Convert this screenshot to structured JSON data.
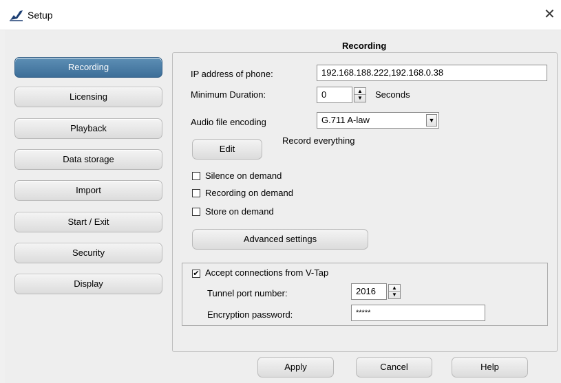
{
  "window": {
    "title": "Setup"
  },
  "section_title": "Recording",
  "sidebar": {
    "items": [
      {
        "label": "Recording",
        "active": true
      },
      {
        "label": "Licensing"
      },
      {
        "label": "Playback"
      },
      {
        "label": "Data storage"
      },
      {
        "label": "Import"
      },
      {
        "label": "Start / Exit"
      },
      {
        "label": "Security"
      },
      {
        "label": "Display"
      }
    ]
  },
  "form": {
    "ip_label": "IP address of phone:",
    "ip_value": "192.168.188.222,192.168.0.38",
    "min_duration_label": "Minimum Duration:",
    "min_duration_value": "0",
    "min_duration_unit": "Seconds",
    "encoding_label": "Audio file encoding",
    "encoding_value": "G.711 A-law",
    "edit_button": "Edit",
    "record_mode": "Record everything",
    "silence_on_demand": {
      "label": "Silence on demand",
      "checked": false
    },
    "recording_on_demand": {
      "label": "Recording on demand",
      "checked": false
    },
    "store_on_demand": {
      "label": "Store on demand",
      "checked": false
    },
    "advanced_button": "Advanced settings"
  },
  "vtap": {
    "accept_label": "Accept connections from V-Tap",
    "accept_checked": true,
    "tunnel_port_label": "Tunnel port number:",
    "tunnel_port_value": "2016",
    "encryption_label": "Encryption password:",
    "encryption_value": "*****"
  },
  "footer": {
    "apply": "Apply",
    "cancel": "Cancel",
    "help": "Help"
  },
  "colors": {
    "active_nav": "#3d6e98",
    "window_bg": "#eeeeee",
    "titlebar_bg": "#ffffff"
  }
}
